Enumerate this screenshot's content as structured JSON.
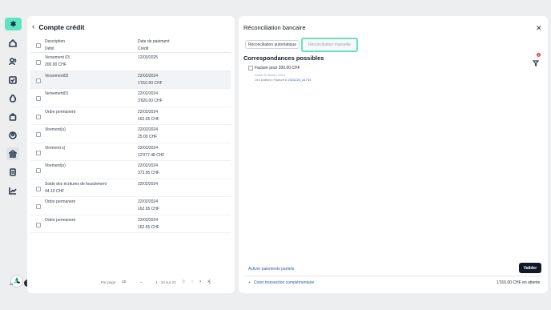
{
  "sidebar": {
    "logo_text": "✱",
    "icons": [
      "home-icon",
      "users-icon",
      "checklist-icon",
      "moneybag-icon",
      "shopping-bag-icon",
      "user-circle-icon",
      "bank-icon",
      "documents-icon",
      "chart-icon"
    ],
    "active": "bank-icon",
    "avatar_sub": "AL",
    "notification_count": "3"
  },
  "left_panel": {
    "back_icon": "‹",
    "title": "Compte crédit",
    "headers": {
      "col1_line1": "Description",
      "col1_line2": "Débit",
      "col2_line1": "Date de paiement",
      "col2_line2": "Crédit"
    },
    "rows": [
      {
        "desc": "Versement 03",
        "debit": "200.00 CHF",
        "date": "12/03/2025",
        "credit": ""
      },
      {
        "desc": "Versement02",
        "debit": "",
        "date": "22/02/2024",
        "credit": "1'010.00 CHF"
      },
      {
        "desc": "Versement01",
        "debit": "",
        "date": "22/02/2024",
        "credit": "3'820.00 CHF"
      },
      {
        "desc": "Ordre permanent",
        "debit": "",
        "date": "22/02/2024",
        "credit": "162.65 CHF"
      },
      {
        "desc": "Virement(s)",
        "debit": "",
        "date": "22/02/2024",
        "credit": "25.00 CHF"
      },
      {
        "desc": "Virement s)",
        "debit": "",
        "date": "22/02/2024",
        "credit": "12'077.48 CHF"
      },
      {
        "desc": "Virement(s)",
        "debit": "",
        "date": "22/02/2024",
        "credit": "373.95 CHF"
      },
      {
        "desc": "Solde des écritures de bouclement",
        "debit": "44.10 CHF",
        "date": "22/02/2024",
        "credit": ""
      },
      {
        "desc": "Ordre permanent",
        "debit": "",
        "date": "22/02/2024",
        "credit": "162.65 CHF"
      },
      {
        "desc": "Ordre permanent",
        "debit": "",
        "date": "22/02/2024",
        "credit": "162.65 CHF"
      }
    ],
    "highlighted_row": 1,
    "pagination": {
      "per_page_label": "Par page",
      "per_page_value": "10",
      "range": "1 - 10 sur 23"
    }
  },
  "right_panel": {
    "title": "Réconciliation bancaire",
    "tab_auto": "Réconciliation automatique",
    "tab_manual": "Réconciliation manuelle",
    "matches_title": "Correspondances possibles",
    "filter_badge": "1",
    "match": {
      "title": "Facture pour 200.00 CHF",
      "date": "mardi 20 février 2024",
      "ref_prefix": "Léo Dubois | Facture ",
      "ref_link": "# 2024220_a1734"
    },
    "activate_partial": "Activer paiements partiels",
    "validate": "Valider",
    "create_transaction": "Créer transaction complémentaire",
    "pending": "1'010.00 CHF en attente"
  },
  "colors": {
    "accent": "#5fe3c0",
    "dark": "#111827",
    "link": "#2f5aa8"
  }
}
